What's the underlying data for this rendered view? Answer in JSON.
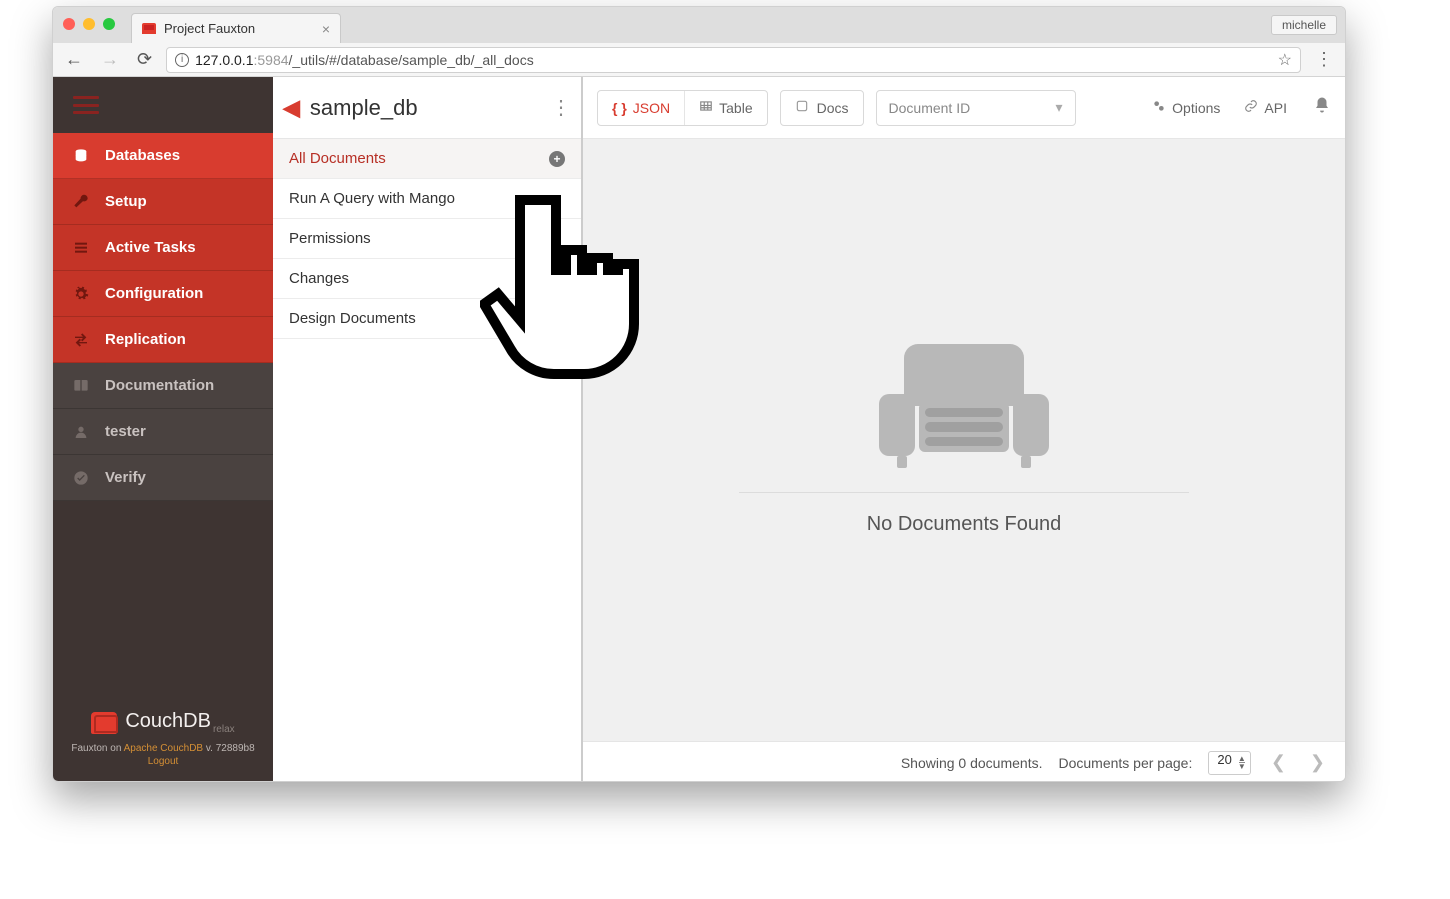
{
  "browser": {
    "tab_title": "Project Fauxton",
    "url_host": "127.0.0.1",
    "url_port": ":5984",
    "url_path": "/_utils/#/database/sample_db/_all_docs",
    "profile": "michelle"
  },
  "sidebar": {
    "items": [
      {
        "label": "Databases",
        "icon": "database-icon",
        "state": "active"
      },
      {
        "label": "Setup",
        "icon": "wrench-icon",
        "state": "red"
      },
      {
        "label": "Active Tasks",
        "icon": "tasks-icon",
        "state": "red"
      },
      {
        "label": "Configuration",
        "icon": "gear-icon",
        "state": "red"
      },
      {
        "label": "Replication",
        "icon": "replication-icon",
        "state": "red"
      },
      {
        "label": "Documentation",
        "icon": "book-icon",
        "state": "dim"
      },
      {
        "label": "tester",
        "icon": "user-icon",
        "state": "dim"
      },
      {
        "label": "Verify",
        "icon": "check-icon",
        "state": "dim"
      }
    ],
    "logo_text": "CouchDB",
    "logo_sub": "relax",
    "foot_prefix": "Fauxton on ",
    "foot_link": "Apache CouchDB",
    "foot_version": " v. 72889b8",
    "logout": "Logout"
  },
  "subnav": {
    "db_name": "sample_db",
    "items": [
      {
        "label": "All Documents",
        "active": true,
        "add": true
      },
      {
        "label": "Run A Query with Mango"
      },
      {
        "label": "Permissions"
      },
      {
        "label": "Changes"
      },
      {
        "label": "Design Documents"
      }
    ]
  },
  "toolbar": {
    "json": "JSON",
    "table": "Table",
    "docs": "Docs",
    "doc_dd": "Document ID",
    "options": "Options",
    "api": "API"
  },
  "empty": {
    "msg": "No Documents Found"
  },
  "pager": {
    "showing": "Showing 0 documents.",
    "perpage_label": "Documents per page:",
    "perpage_value": "20"
  }
}
